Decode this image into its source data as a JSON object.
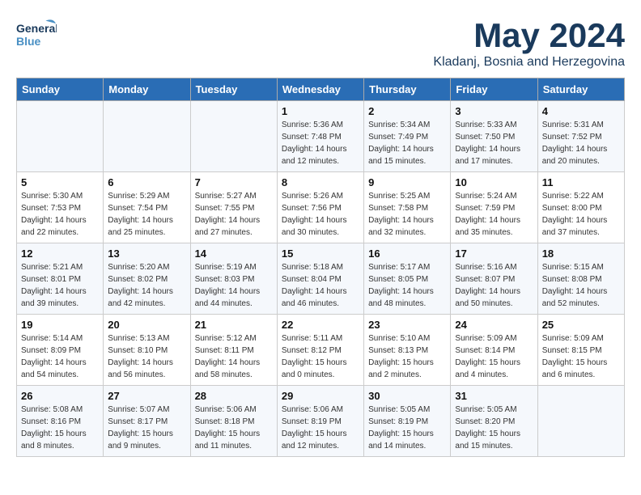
{
  "header": {
    "logo_general": "General",
    "logo_blue": "Blue",
    "month": "May 2024",
    "location": "Kladanj, Bosnia and Herzegovina"
  },
  "columns": [
    "Sunday",
    "Monday",
    "Tuesday",
    "Wednesday",
    "Thursday",
    "Friday",
    "Saturday"
  ],
  "weeks": [
    [
      {
        "day": "",
        "info": ""
      },
      {
        "day": "",
        "info": ""
      },
      {
        "day": "",
        "info": ""
      },
      {
        "day": "1",
        "info": "Sunrise: 5:36 AM\nSunset: 7:48 PM\nDaylight: 14 hours\nand 12 minutes."
      },
      {
        "day": "2",
        "info": "Sunrise: 5:34 AM\nSunset: 7:49 PM\nDaylight: 14 hours\nand 15 minutes."
      },
      {
        "day": "3",
        "info": "Sunrise: 5:33 AM\nSunset: 7:50 PM\nDaylight: 14 hours\nand 17 minutes."
      },
      {
        "day": "4",
        "info": "Sunrise: 5:31 AM\nSunset: 7:52 PM\nDaylight: 14 hours\nand 20 minutes."
      }
    ],
    [
      {
        "day": "5",
        "info": "Sunrise: 5:30 AM\nSunset: 7:53 PM\nDaylight: 14 hours\nand 22 minutes."
      },
      {
        "day": "6",
        "info": "Sunrise: 5:29 AM\nSunset: 7:54 PM\nDaylight: 14 hours\nand 25 minutes."
      },
      {
        "day": "7",
        "info": "Sunrise: 5:27 AM\nSunset: 7:55 PM\nDaylight: 14 hours\nand 27 minutes."
      },
      {
        "day": "8",
        "info": "Sunrise: 5:26 AM\nSunset: 7:56 PM\nDaylight: 14 hours\nand 30 minutes."
      },
      {
        "day": "9",
        "info": "Sunrise: 5:25 AM\nSunset: 7:58 PM\nDaylight: 14 hours\nand 32 minutes."
      },
      {
        "day": "10",
        "info": "Sunrise: 5:24 AM\nSunset: 7:59 PM\nDaylight: 14 hours\nand 35 minutes."
      },
      {
        "day": "11",
        "info": "Sunrise: 5:22 AM\nSunset: 8:00 PM\nDaylight: 14 hours\nand 37 minutes."
      }
    ],
    [
      {
        "day": "12",
        "info": "Sunrise: 5:21 AM\nSunset: 8:01 PM\nDaylight: 14 hours\nand 39 minutes."
      },
      {
        "day": "13",
        "info": "Sunrise: 5:20 AM\nSunset: 8:02 PM\nDaylight: 14 hours\nand 42 minutes."
      },
      {
        "day": "14",
        "info": "Sunrise: 5:19 AM\nSunset: 8:03 PM\nDaylight: 14 hours\nand 44 minutes."
      },
      {
        "day": "15",
        "info": "Sunrise: 5:18 AM\nSunset: 8:04 PM\nDaylight: 14 hours\nand 46 minutes."
      },
      {
        "day": "16",
        "info": "Sunrise: 5:17 AM\nSunset: 8:05 PM\nDaylight: 14 hours\nand 48 minutes."
      },
      {
        "day": "17",
        "info": "Sunrise: 5:16 AM\nSunset: 8:07 PM\nDaylight: 14 hours\nand 50 minutes."
      },
      {
        "day": "18",
        "info": "Sunrise: 5:15 AM\nSunset: 8:08 PM\nDaylight: 14 hours\nand 52 minutes."
      }
    ],
    [
      {
        "day": "19",
        "info": "Sunrise: 5:14 AM\nSunset: 8:09 PM\nDaylight: 14 hours\nand 54 minutes."
      },
      {
        "day": "20",
        "info": "Sunrise: 5:13 AM\nSunset: 8:10 PM\nDaylight: 14 hours\nand 56 minutes."
      },
      {
        "day": "21",
        "info": "Sunrise: 5:12 AM\nSunset: 8:11 PM\nDaylight: 14 hours\nand 58 minutes."
      },
      {
        "day": "22",
        "info": "Sunrise: 5:11 AM\nSunset: 8:12 PM\nDaylight: 15 hours\nand 0 minutes."
      },
      {
        "day": "23",
        "info": "Sunrise: 5:10 AM\nSunset: 8:13 PM\nDaylight: 15 hours\nand 2 minutes."
      },
      {
        "day": "24",
        "info": "Sunrise: 5:09 AM\nSunset: 8:14 PM\nDaylight: 15 hours\nand 4 minutes."
      },
      {
        "day": "25",
        "info": "Sunrise: 5:09 AM\nSunset: 8:15 PM\nDaylight: 15 hours\nand 6 minutes."
      }
    ],
    [
      {
        "day": "26",
        "info": "Sunrise: 5:08 AM\nSunset: 8:16 PM\nDaylight: 15 hours\nand 8 minutes."
      },
      {
        "day": "27",
        "info": "Sunrise: 5:07 AM\nSunset: 8:17 PM\nDaylight: 15 hours\nand 9 minutes."
      },
      {
        "day": "28",
        "info": "Sunrise: 5:06 AM\nSunset: 8:18 PM\nDaylight: 15 hours\nand 11 minutes."
      },
      {
        "day": "29",
        "info": "Sunrise: 5:06 AM\nSunset: 8:19 PM\nDaylight: 15 hours\nand 12 minutes."
      },
      {
        "day": "30",
        "info": "Sunrise: 5:05 AM\nSunset: 8:19 PM\nDaylight: 15 hours\nand 14 minutes."
      },
      {
        "day": "31",
        "info": "Sunrise: 5:05 AM\nSunset: 8:20 PM\nDaylight: 15 hours\nand 15 minutes."
      },
      {
        "day": "",
        "info": ""
      }
    ]
  ]
}
